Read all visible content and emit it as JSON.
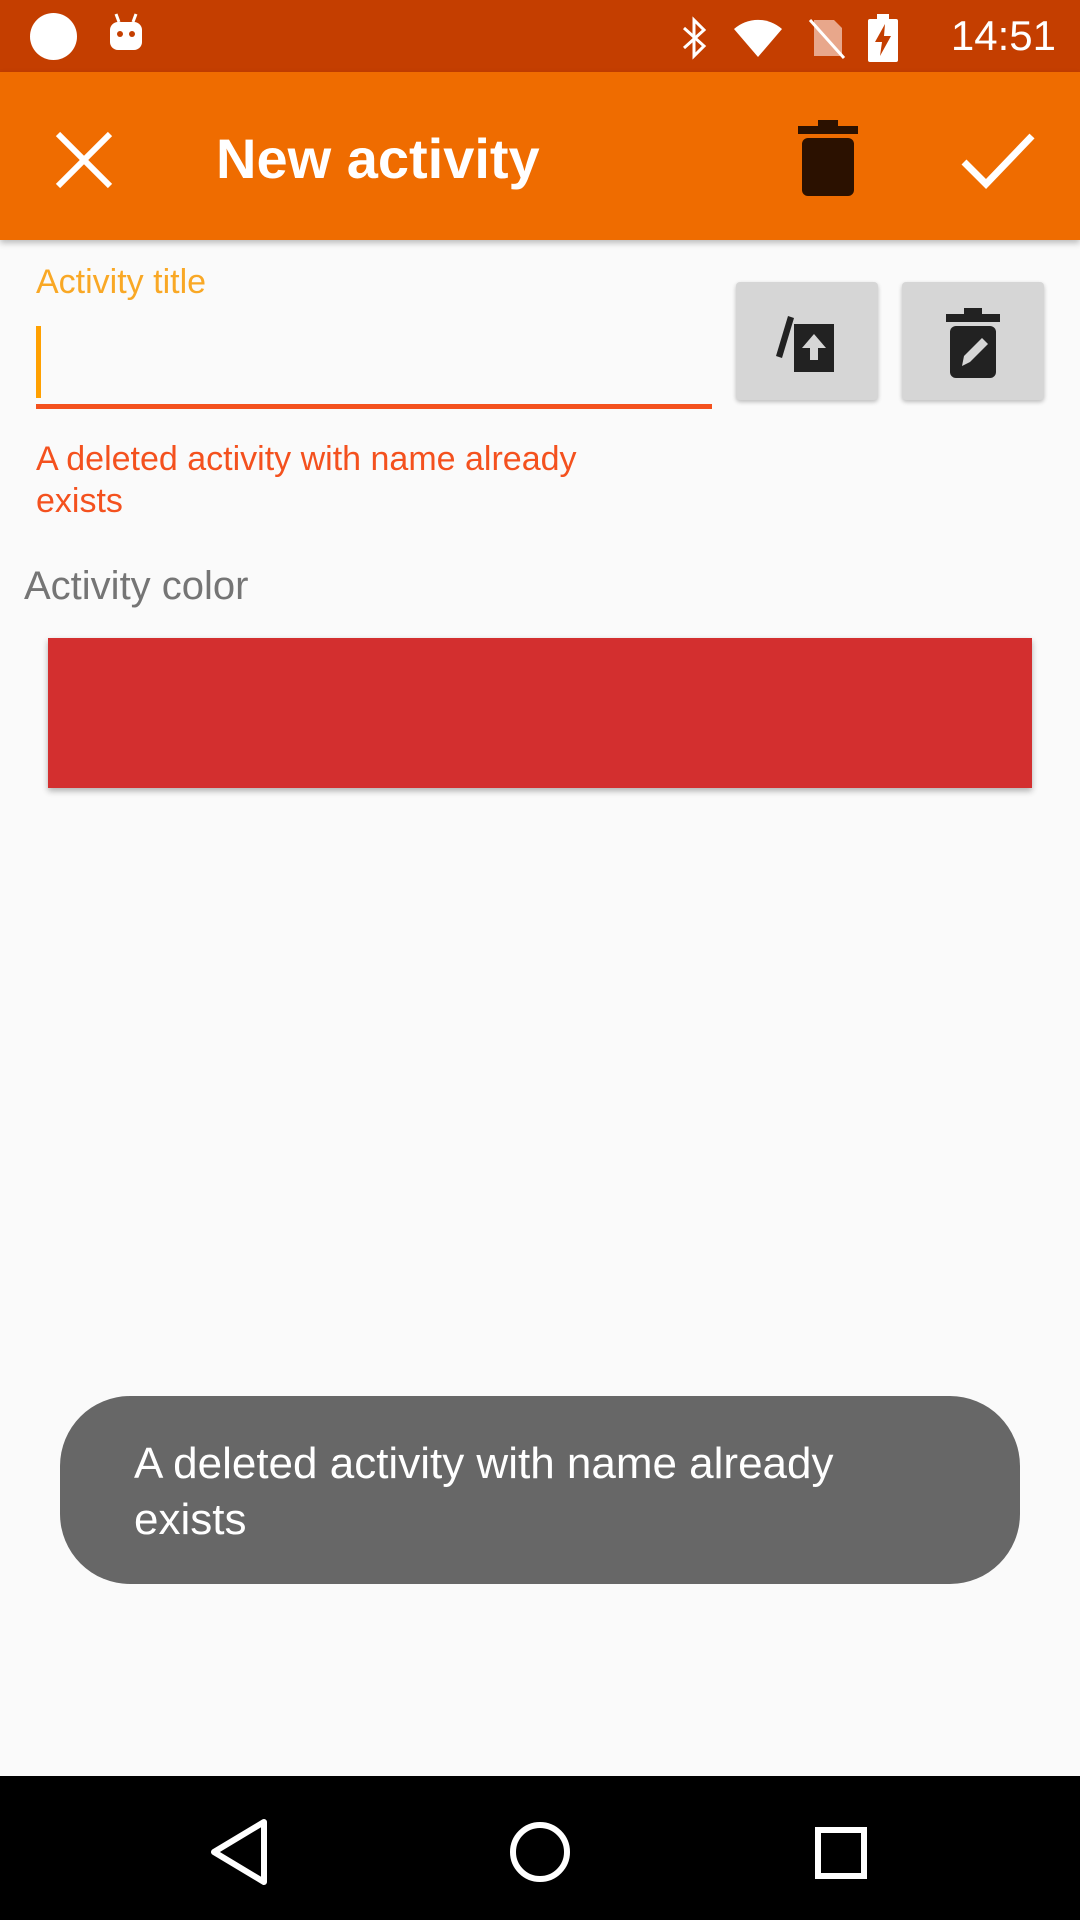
{
  "status_bar": {
    "time": "14:51",
    "icons": [
      "circle-notification-icon",
      "android-icon",
      "bluetooth-icon",
      "wifi-icon",
      "no-sim-icon",
      "battery-charging-icon"
    ]
  },
  "app_bar": {
    "title": "New activity",
    "close_icon": "close-icon",
    "delete_icon": "trash-icon",
    "confirm_icon": "check-icon",
    "background": "#ef6c00"
  },
  "form": {
    "title_label": "Activity title",
    "title_value": "",
    "error": "A deleted activity with name  already exists",
    "restore_button_icon": "restore-upload-icon",
    "edit_deleted_button_icon": "edit-trash-icon",
    "color_label": "Activity color",
    "selected_color": "#d32f2f"
  },
  "toast": {
    "message": "A deleted activity with name  already exists"
  },
  "nav_bar": {
    "buttons": [
      "back-icon",
      "home-icon",
      "recents-icon"
    ]
  }
}
